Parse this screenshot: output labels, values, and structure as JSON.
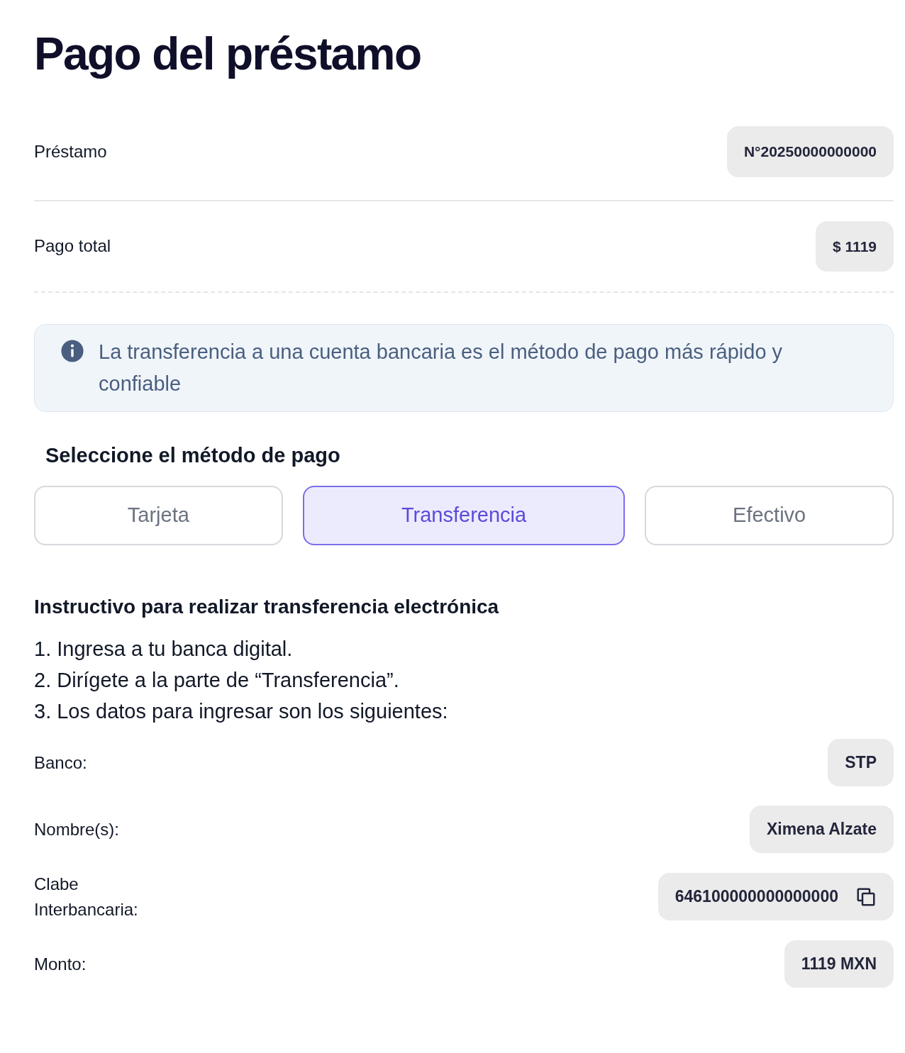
{
  "title": "Pago del préstamo",
  "summary": [
    {
      "label": "Préstamo",
      "value": "N°20250000000000",
      "kind": "solid"
    },
    {
      "label": "Pago total",
      "value": "$ 1119",
      "kind": "dashed"
    }
  ],
  "notice": {
    "text": "La transferencia a una cuenta bancaria es el método de pago más rápido y confiable"
  },
  "method_heading": "Seleccione el método de pago",
  "tabs": [
    {
      "label": "Tarjeta",
      "selected": false
    },
    {
      "label": "Transferencia",
      "selected": true
    },
    {
      "label": "Efectivo",
      "selected": false
    }
  ],
  "instructions": {
    "heading": "Instructivo para realizar transferencia electrónica",
    "steps": [
      "1. Ingresa a tu banca digital.",
      "2. Dirígete a la parte de “Transferencia”.",
      "3. Los datos para ingresar son los siguientes:"
    ]
  },
  "details": [
    {
      "label": "Banco:",
      "value": "STP",
      "copyable": false
    },
    {
      "label": "Nombre(s):",
      "value": "Ximena Alzate",
      "copyable": false
    },
    {
      "label": "Clabe Interbancaria:",
      "value": "646100000000000000",
      "copyable": true
    },
    {
      "label": "Monto:",
      "value": "1119 MXN",
      "copyable": false
    }
  ]
}
